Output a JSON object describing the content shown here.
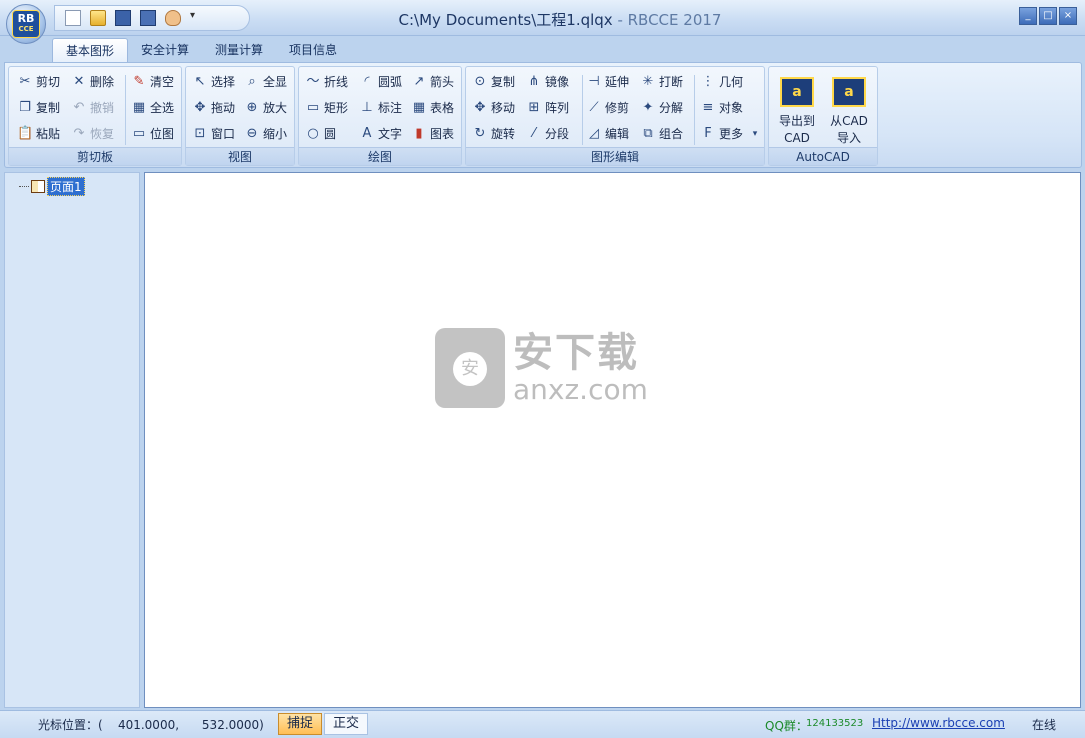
{
  "window": {
    "title": "C:\\My Documents\\工程1.qlqx",
    "brand": " - RBCCE 2017",
    "logo_text": "RB",
    "logo_sub": "CCE",
    "min": "_",
    "max": "□",
    "close": "×"
  },
  "quick_access": {
    "more": "▾"
  },
  "tabs": [
    "基本图形",
    "安全计算",
    "测量计算",
    "项目信息"
  ],
  "ribbon": {
    "clipboard": {
      "label": "剪切板",
      "cut": "剪切",
      "delete": "删除",
      "clear": "清空",
      "copy": "复制",
      "undo": "撤销",
      "select_all": "全选",
      "paste": "粘贴",
      "redo": "恢复",
      "bitmap": "位图"
    },
    "view": {
      "label": "视图",
      "select": "选择",
      "fit_all": "全显",
      "pan": "拖动",
      "zoom_in": "放大",
      "window": "窗口",
      "zoom_out": "缩小"
    },
    "draw": {
      "label": "绘图",
      "polyline": "折线",
      "arc": "圆弧",
      "arrow": "箭头",
      "rect": "矩形",
      "dimension": "标注",
      "table": "表格",
      "circle": "圆",
      "text": "文字",
      "chart": "图表"
    },
    "edit": {
      "label": "图形编辑",
      "copy": "复制",
      "mirror": "镜像",
      "extend": "延伸",
      "break": "打断",
      "geometry": "几何",
      "move": "移动",
      "array": "阵列",
      "trim": "修剪",
      "explode": "分解",
      "object": "对象",
      "rotate": "旋转",
      "divide": "分段",
      "edit": "编辑",
      "group": "组合",
      "more": "更多"
    },
    "autocad": {
      "label": "AutoCAD",
      "export_l1": "导出到",
      "export_l2": "CAD",
      "import_l1": "从CAD",
      "import_l2": "导入"
    }
  },
  "tree": {
    "page": "页面1"
  },
  "watermark": {
    "cn": "安下载",
    "en": "anxz.com"
  },
  "status": {
    "cursor_label": "光标位置：(",
    "cursor_x": "401.0000,",
    "cursor_y": "532.0000)",
    "snap": "捕捉",
    "ortho": "正交",
    "qq_label": "QQ群：",
    "qq_number": "124133523",
    "website": "Http://www.rbcce.com",
    "online": "在线"
  }
}
